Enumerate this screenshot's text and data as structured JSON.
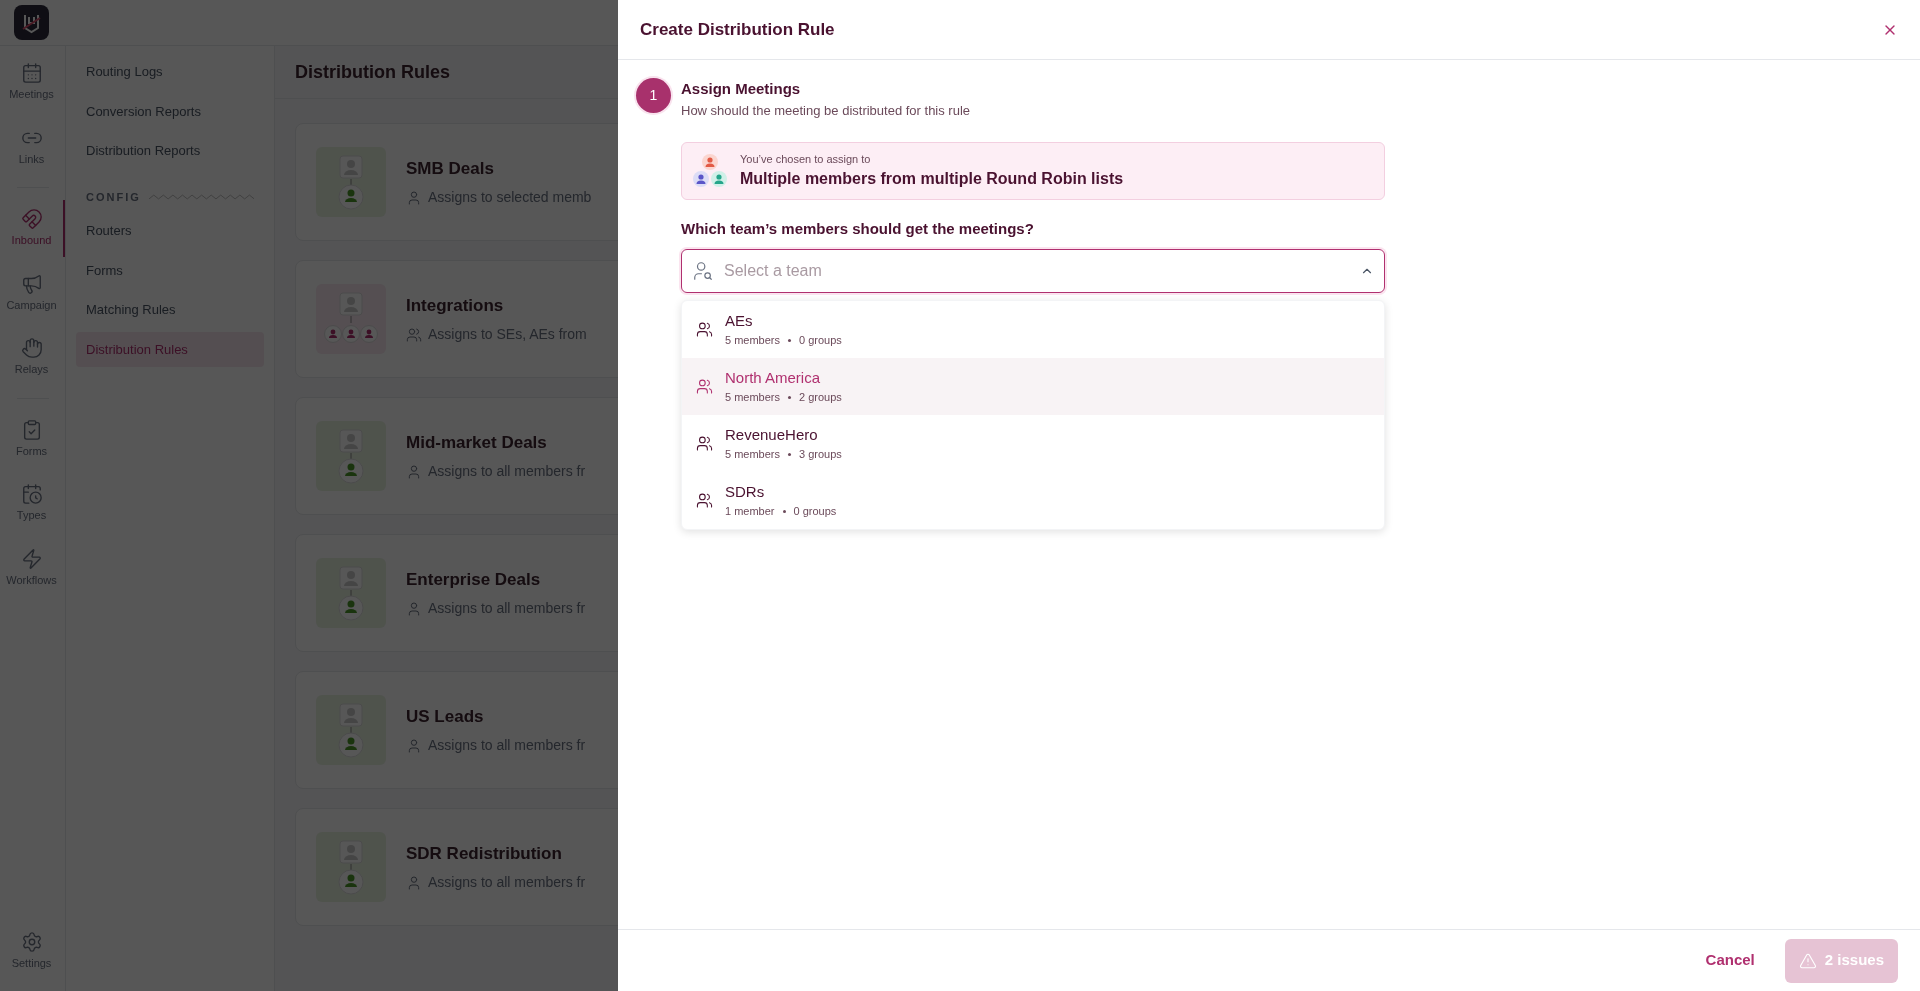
{
  "rail": {
    "groups": [
      [
        {
          "label": "Meetings",
          "selected": false
        },
        {
          "label": "Links",
          "selected": false
        }
      ],
      [
        {
          "label": "Inbound",
          "selected": true
        },
        {
          "label": "Campaign",
          "selected": false
        },
        {
          "label": "Relays",
          "selected": false
        }
      ],
      [
        {
          "label": "Forms",
          "selected": false
        },
        {
          "label": "Types",
          "selected": false
        },
        {
          "label": "Workflows",
          "selected": false
        }
      ]
    ],
    "bottom": [
      {
        "label": "Settings",
        "selected": false
      }
    ]
  },
  "subnav": {
    "reports": [
      {
        "label": "Routing Logs",
        "selected": false
      },
      {
        "label": "Conversion Reports",
        "selected": false
      },
      {
        "label": "Distribution Reports",
        "selected": false
      }
    ],
    "config_heading": "CONFIG",
    "config": [
      {
        "label": "Routers",
        "selected": false
      },
      {
        "label": "Forms",
        "selected": false
      },
      {
        "label": "Matching Rules",
        "selected": false
      },
      {
        "label": "Distribution Rules",
        "selected": true
      }
    ]
  },
  "main": {
    "title": "Distribution Rules",
    "rules": [
      {
        "name": "SMB Deals",
        "description": "Assigns to selected memb",
        "kind": "single"
      },
      {
        "name": "Integrations",
        "description": "Assigns to SEs, AEs from",
        "kind": "multi"
      },
      {
        "name": "Mid-market Deals",
        "description": "Assigns to all members fr",
        "kind": "single"
      },
      {
        "name": "Enterprise Deals",
        "description": "Assigns to all members fr",
        "kind": "single"
      },
      {
        "name": "US Leads",
        "description": "Assigns to all members fr",
        "kind": "single"
      },
      {
        "name": "SDR Redistribution",
        "description": "Assigns to all members fr",
        "kind": "single"
      }
    ]
  },
  "dialog": {
    "title": "Create Distribution Rule",
    "step": {
      "number": "1",
      "title": "Assign Meetings",
      "subtitle": "How should the meeting be distributed for this rule"
    },
    "choice": {
      "caption": "You’ve chosen to assign to",
      "value": "Multiple members from multiple Round Robin lists"
    },
    "question": "Which team’s members should get the meetings?",
    "select": {
      "placeholder": "Select a team",
      "expanded": true
    },
    "options": [
      {
        "name": "AEs",
        "members": "5 members",
        "groups": "0 groups",
        "selected": false
      },
      {
        "name": "North America",
        "members": "5 members",
        "groups": "2 groups",
        "selected": true
      },
      {
        "name": "RevenueHero",
        "members": "5 members",
        "groups": "3 groups",
        "selected": false
      },
      {
        "name": "SDRs",
        "members": "1 member",
        "groups": "0 groups",
        "selected": false
      }
    ],
    "footer": {
      "cancel": "Cancel",
      "issues": "2 issues",
      "disabled": true
    }
  }
}
